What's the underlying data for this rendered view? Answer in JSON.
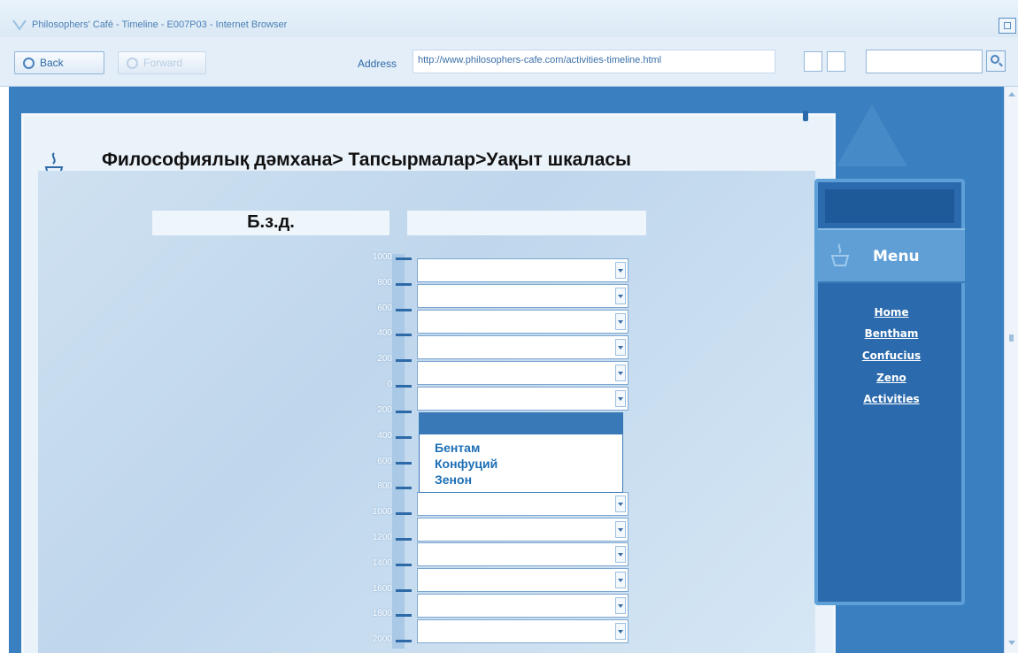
{
  "window": {
    "title": "Philosophers' Café - Timeline - E007P03 - Internet Browser"
  },
  "toolbar": {
    "back_label": "Back",
    "forward_label": "Forward",
    "address_label": "Address",
    "address_value": "http://www.philosophers-cafe.com/activities-timeline.html",
    "search_value": ""
  },
  "page": {
    "breadcrumb": "Философиялық дәмхана> Тапсырмалар>Уақыт шкаласы",
    "header_left": "Б.з.д.",
    "header_right": "",
    "timeline_ticks": [
      "1000",
      "800",
      "600",
      "400",
      "200",
      "0",
      "200",
      "400",
      "600",
      "800",
      "1000",
      "1200",
      "1400",
      "1600",
      "1800",
      "2000"
    ],
    "open_dropdown_options": [
      "Бентам",
      "Конфуций",
      "Зенон"
    ]
  },
  "menu": {
    "title": "Menu",
    "links": [
      "Home",
      "Bentham",
      "Confucius",
      "Zeno",
      "Activities"
    ]
  },
  "colors": {
    "page_background": "#3a7fbf",
    "accent": "#1d6fb5",
    "menu_background": "#2b6aac"
  }
}
